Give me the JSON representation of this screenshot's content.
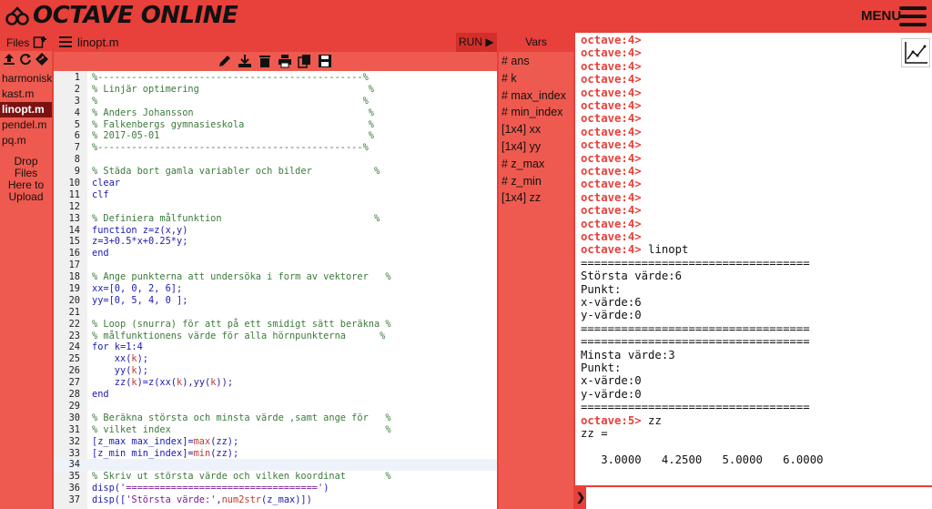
{
  "app": {
    "brand": "OCTAVE ONLINE",
    "menu_label": "MENU",
    "accent_color": "#e8403a",
    "dark_accent": "#7a1212"
  },
  "files_panel": {
    "title": "Files",
    "items": [
      {
        "label": "harmonisk.",
        "active": false
      },
      {
        "label": "kast.m",
        "active": false
      },
      {
        "label": "linopt.m",
        "active": true
      },
      {
        "label": "pendel.m",
        "active": false
      },
      {
        "label": "pq.m",
        "active": false
      }
    ],
    "dropzone": "Drop\nFiles\nHere to\nUpload",
    "tool_icons": [
      "upload-icon",
      "refresh-icon",
      "share-icon"
    ]
  },
  "editor": {
    "filename": "linopt.m",
    "run_label": "RUN ▶",
    "toolbar_icons": [
      "edit-icon",
      "download-icon",
      "delete-icon",
      "print-icon",
      "copy-icon",
      "save-icon"
    ],
    "current_line": 34,
    "lines": [
      {
        "n": "1",
        "parts": [
          [
            "cm",
            "%-----------------------------------------------%"
          ]
        ]
      },
      {
        "n": "2",
        "parts": [
          [
            "cm",
            "% Linjär optimering                              %"
          ]
        ]
      },
      {
        "n": "3",
        "parts": [
          [
            "cm",
            "%                                               %"
          ]
        ]
      },
      {
        "n": "4",
        "parts": [
          [
            "cm",
            "% Anders Johansson                               %"
          ]
        ]
      },
      {
        "n": "5",
        "parts": [
          [
            "cm",
            "% Falkenbergs gymnasieskola                      %"
          ]
        ]
      },
      {
        "n": "6",
        "parts": [
          [
            "cm",
            "% 2017-05-01                                     %"
          ]
        ]
      },
      {
        "n": "7",
        "parts": [
          [
            "cm",
            "%-----------------------------------------------%"
          ]
        ]
      },
      {
        "n": "8",
        "parts": [
          [
            "pl",
            ""
          ]
        ]
      },
      {
        "n": "9",
        "parts": [
          [
            "cm",
            "% Städa bort gamla variabler och bilder           %"
          ]
        ]
      },
      {
        "n": "10",
        "parts": [
          [
            "kw",
            "clear"
          ]
        ]
      },
      {
        "n": "11",
        "parts": [
          [
            "kw",
            "clf"
          ]
        ]
      },
      {
        "n": "12",
        "parts": [
          [
            "pl",
            ""
          ]
        ]
      },
      {
        "n": "13",
        "parts": [
          [
            "cm",
            "% Definiera målfunktion                           %"
          ]
        ]
      },
      {
        "n": "14",
        "parts": [
          [
            "kw",
            "function"
          ],
          [
            "kw",
            " z=z(x,y)"
          ]
        ]
      },
      {
        "n": "15",
        "parts": [
          [
            "kw",
            "z=3+0.5*x+0.25*y;"
          ]
        ]
      },
      {
        "n": "16",
        "parts": [
          [
            "kw",
            "end"
          ]
        ]
      },
      {
        "n": "17",
        "parts": [
          [
            "pl",
            ""
          ]
        ]
      },
      {
        "n": "18",
        "parts": [
          [
            "cm",
            "% Ange punkterna att undersöka i form av vektorer   %"
          ]
        ]
      },
      {
        "n": "19",
        "parts": [
          [
            "kw",
            "xx=[0, 0, 2, 6];"
          ]
        ]
      },
      {
        "n": "20",
        "parts": [
          [
            "kw",
            "yy=[0, 5, 4, 0 ];"
          ]
        ]
      },
      {
        "n": "21",
        "parts": [
          [
            "pl",
            ""
          ]
        ]
      },
      {
        "n": "22",
        "parts": [
          [
            "cm",
            "% Loop (snurra) för att på ett smidigt sätt beräkna %"
          ]
        ]
      },
      {
        "n": "23",
        "parts": [
          [
            "cm",
            "% målfunktionens värde för alla hörnpunkterna      %"
          ]
        ]
      },
      {
        "n": "24",
        "parts": [
          [
            "kw",
            "for k=1:4"
          ]
        ]
      },
      {
        "n": "25",
        "parts": [
          [
            "kw",
            "    xx("
          ],
          [
            "fn",
            "k"
          ],
          [
            "kw",
            ");"
          ]
        ]
      },
      {
        "n": "26",
        "parts": [
          [
            "kw",
            "    yy("
          ],
          [
            "fn",
            "k"
          ],
          [
            "kw",
            ");"
          ]
        ]
      },
      {
        "n": "27",
        "parts": [
          [
            "kw",
            "    zz("
          ],
          [
            "fn",
            "k"
          ],
          [
            "kw",
            ")=z(xx("
          ],
          [
            "fn",
            "k"
          ],
          [
            "kw",
            "),yy("
          ],
          [
            "fn",
            "k"
          ],
          [
            "kw",
            "));"
          ]
        ]
      },
      {
        "n": "28",
        "parts": [
          [
            "kw",
            "end"
          ]
        ]
      },
      {
        "n": "29",
        "parts": [
          [
            "pl",
            ""
          ]
        ]
      },
      {
        "n": "30",
        "parts": [
          [
            "cm",
            "% Beräkna största och minsta värde ,samt ange för   %"
          ]
        ]
      },
      {
        "n": "31",
        "parts": [
          [
            "cm",
            "% vilket index                                      %"
          ]
        ]
      },
      {
        "n": "32",
        "parts": [
          [
            "kw",
            "[z_max max_index]="
          ],
          [
            "fn",
            "max"
          ],
          [
            "kw",
            "(zz);"
          ]
        ]
      },
      {
        "n": "33",
        "parts": [
          [
            "kw",
            "[z_min min_index]="
          ],
          [
            "fn",
            "min"
          ],
          [
            "kw",
            "(zz);"
          ]
        ]
      },
      {
        "n": "34",
        "parts": [
          [
            "pl",
            ""
          ]
        ]
      },
      {
        "n": "35",
        "parts": [
          [
            "cm",
            "% Skriv ut största värde och vilken koordinat       %"
          ]
        ]
      },
      {
        "n": "36",
        "parts": [
          [
            "kw",
            "disp("
          ],
          [
            "st",
            "'=================================='"
          ],
          [
            "kw",
            ")"
          ]
        ]
      },
      {
        "n": "37",
        "parts": [
          [
            "kw",
            "disp(["
          ],
          [
            "st",
            "'Största värde:'"
          ],
          [
            "kw",
            ","
          ],
          [
            "fn",
            "num2str"
          ],
          [
            "kw",
            "(z_max)])"
          ]
        ]
      }
    ]
  },
  "vars_panel": {
    "title": "Vars",
    "items": [
      "# ans",
      "# k",
      "# max_index",
      "# min_index",
      "[1x4] xx",
      "[1x4] yy",
      "# z_max",
      "# z_min",
      "[1x4] zz"
    ]
  },
  "console": {
    "lines": [
      {
        "prompt": "octave:4>",
        "text": ""
      },
      {
        "prompt": "octave:4>",
        "text": ""
      },
      {
        "prompt": "octave:4>",
        "text": ""
      },
      {
        "prompt": "octave:4>",
        "text": ""
      },
      {
        "prompt": "octave:4>",
        "text": ""
      },
      {
        "prompt": "octave:4>",
        "text": ""
      },
      {
        "prompt": "octave:4>",
        "text": ""
      },
      {
        "prompt": "octave:4>",
        "text": ""
      },
      {
        "prompt": "octave:4>",
        "text": ""
      },
      {
        "prompt": "octave:4>",
        "text": ""
      },
      {
        "prompt": "octave:4>",
        "text": ""
      },
      {
        "prompt": "octave:4>",
        "text": ""
      },
      {
        "prompt": "octave:4>",
        "text": ""
      },
      {
        "prompt": "octave:4>",
        "text": ""
      },
      {
        "prompt": "octave:4>",
        "text": ""
      },
      {
        "prompt": "octave:4>",
        "text": ""
      },
      {
        "prompt": "octave:4>",
        "text": " linopt"
      },
      {
        "prompt": "",
        "text": "=================================="
      },
      {
        "prompt": "",
        "text": "Största värde:6"
      },
      {
        "prompt": "",
        "text": "Punkt:"
      },
      {
        "prompt": "",
        "text": "x-värde:6"
      },
      {
        "prompt": "",
        "text": "y-värde:0"
      },
      {
        "prompt": "",
        "text": "=================================="
      },
      {
        "prompt": "",
        "text": "=================================="
      },
      {
        "prompt": "",
        "text": "Minsta värde:3"
      },
      {
        "prompt": "",
        "text": "Punkt:"
      },
      {
        "prompt": "",
        "text": "x-värde:0"
      },
      {
        "prompt": "",
        "text": "y-värde:0"
      },
      {
        "prompt": "",
        "text": "=================================="
      },
      {
        "prompt": "octave:5>",
        "text": " zz"
      },
      {
        "prompt": "",
        "text": "zz ="
      },
      {
        "prompt": "",
        "text": ""
      },
      {
        "prompt": "",
        "text": "   3.0000   4.2500   5.0000   6.0000"
      }
    ],
    "input_caret": "❯",
    "input_value": ""
  }
}
